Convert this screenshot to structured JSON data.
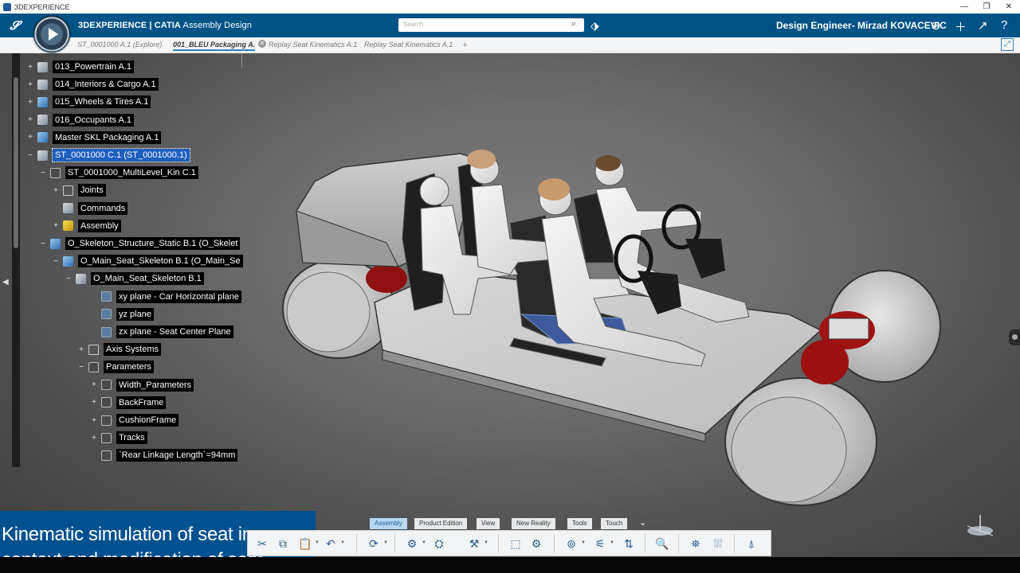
{
  "os_window": {
    "title": "3DEXPERIENCE",
    "minimize": "—",
    "restore": "❐",
    "close": "✕"
  },
  "header": {
    "brand": "3DEXPERIENCE | ",
    "app": "CATIA",
    "app_sub": " Assembly Design",
    "search_placeholder": "Search",
    "user": "Design Engineer- Mirzad KOVACEVIC",
    "accent_color": "#005386"
  },
  "tabs": [
    {
      "label": "ST_0001000 A.1 (Explore)"
    },
    {
      "label": "001_BLEU Packaging A."
    },
    {
      "label": "Replay Seat Kinematics A.1"
    },
    {
      "label": "Replay Seat Kinematics A.1"
    }
  ],
  "tree": [
    {
      "label": "013_Powertrain A.1",
      "toggle": "+",
      "icon": "ic-gear"
    },
    {
      "label": "014_Interiors & Cargo A.1",
      "toggle": "+",
      "icon": "ic-gear"
    },
    {
      "label": "015_Wheels & Tires A.1",
      "toggle": "+",
      "icon": "ic-blue"
    },
    {
      "label": "016_Occupants A.1",
      "toggle": "+",
      "icon": "ic-gear"
    },
    {
      "label": "Master SKL Packaging A.1",
      "toggle": "+",
      "icon": "ic-blue"
    },
    {
      "label": "ST_0001000 C.1 (ST_0001000.1)",
      "toggle": "−",
      "icon": "ic-gear",
      "selected": true
    },
    {
      "label": "ST_0001000_MultiLevel_Kin C.1",
      "toggle": "−",
      "icon": "ic-param"
    },
    {
      "label": "Joints",
      "toggle": "+",
      "icon": "ic-joint"
    },
    {
      "label": "Commands",
      "toggle": "",
      "icon": "ic-gear"
    },
    {
      "label": "Assembly",
      "toggle": "+",
      "icon": "ic-yellow"
    },
    {
      "label": "O_Skeleton_Structure_Static B.1 (O_Skelet",
      "toggle": "−",
      "icon": "ic-blue"
    },
    {
      "label": "O_Main_Seat_Skeleton B.1 (O_Main_Se",
      "toggle": "−",
      "icon": "ic-blue"
    },
    {
      "label": "O_Main_Seat_Skeleton B.1",
      "toggle": "−",
      "icon": "ic-gear"
    },
    {
      "label": "xy plane - Car Horizontal plane",
      "toggle": "",
      "icon": "ic-plane"
    },
    {
      "label": "yz plane",
      "toggle": "",
      "icon": "ic-plane"
    },
    {
      "label": "zx plane - Seat Center Plane",
      "toggle": "",
      "icon": "ic-plane"
    },
    {
      "label": "Axis Systems",
      "toggle": "+",
      "icon": "ic-joint"
    },
    {
      "label": "Parameters",
      "toggle": "−",
      "icon": "ic-param"
    },
    {
      "label": "Width_Parameters",
      "toggle": "+",
      "icon": "ic-param"
    },
    {
      "label": "BackFrame",
      "toggle": "+",
      "icon": "ic-param"
    },
    {
      "label": "CushionFrame",
      "toggle": "+",
      "icon": "ic-param"
    },
    {
      "label": "Tracks",
      "toggle": "+",
      "icon": "ic-param"
    },
    {
      "label": "`Rear Linkage Length`=94mm",
      "toggle": "",
      "icon": "ic-param"
    }
  ],
  "caption": {
    "line1": "Kinematic simulation of seat in",
    "line2": "context and modification of seat"
  },
  "section_tabs": [
    "Assembly",
    "Product Edition",
    "View",
    "New Reality",
    "Tools",
    "Touch"
  ],
  "toolbar_icons": [
    {
      "name": "cut-icon",
      "glyph": "✂",
      "caret": false
    },
    {
      "name": "copy-icon",
      "glyph": "⧉",
      "caret": false
    },
    {
      "name": "paste-icon",
      "glyph": "📋",
      "caret": true
    },
    {
      "name": "undo-icon",
      "glyph": "↶",
      "caret": true
    },
    {
      "name": "update-icon",
      "glyph": "⟳",
      "caret": true
    },
    {
      "name": "insert-component-icon",
      "glyph": "⚙",
      "caret": true
    },
    {
      "name": "engineering-connection-icon",
      "glyph": "⛭",
      "caret": false
    },
    {
      "name": "constraint-icon",
      "glyph": "⚒",
      "caret": true
    },
    {
      "name": "mechanism-icon",
      "glyph": "⬚",
      "caret": false
    },
    {
      "name": "kinematics-icon",
      "glyph": "⚙",
      "caret": false
    },
    {
      "name": "snap-icon",
      "glyph": "⊚",
      "caret": true
    },
    {
      "name": "robot-icon",
      "glyph": "⚟",
      "caret": true
    },
    {
      "name": "compass-tool-icon",
      "glyph": "⇅",
      "caret": false
    },
    {
      "name": "zoom-icon",
      "glyph": "🔍",
      "caret": false
    },
    {
      "name": "measure-icon",
      "glyph": "⛯",
      "caret": false
    },
    {
      "name": "section-icon",
      "glyph": "⛆",
      "caret": false
    },
    {
      "name": "explode-icon",
      "glyph": "⍋",
      "caret": false
    }
  ]
}
